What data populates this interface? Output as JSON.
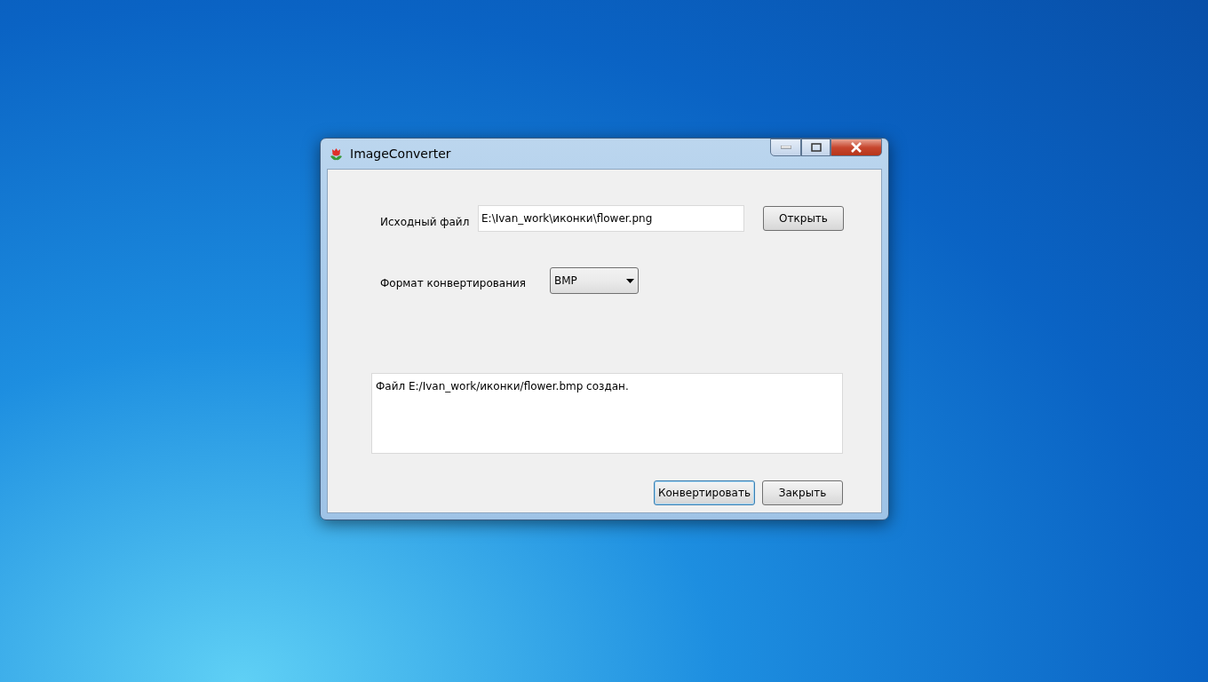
{
  "window": {
    "title": "ImageConverter"
  },
  "source": {
    "label": "Исходный файл",
    "value": "E:\\Ivan_work\\иконки\\flower.png",
    "button": "Открыть"
  },
  "format": {
    "label": "Формат конвертирования",
    "value": "BMP"
  },
  "log": {
    "text": "Файл E:/Ivan_work/иконки/flower.bmp создан."
  },
  "buttons": [
    {
      "label": "Конвертировать",
      "focused": true
    },
    {
      "label": "Закрыть",
      "focused": false
    }
  ]
}
